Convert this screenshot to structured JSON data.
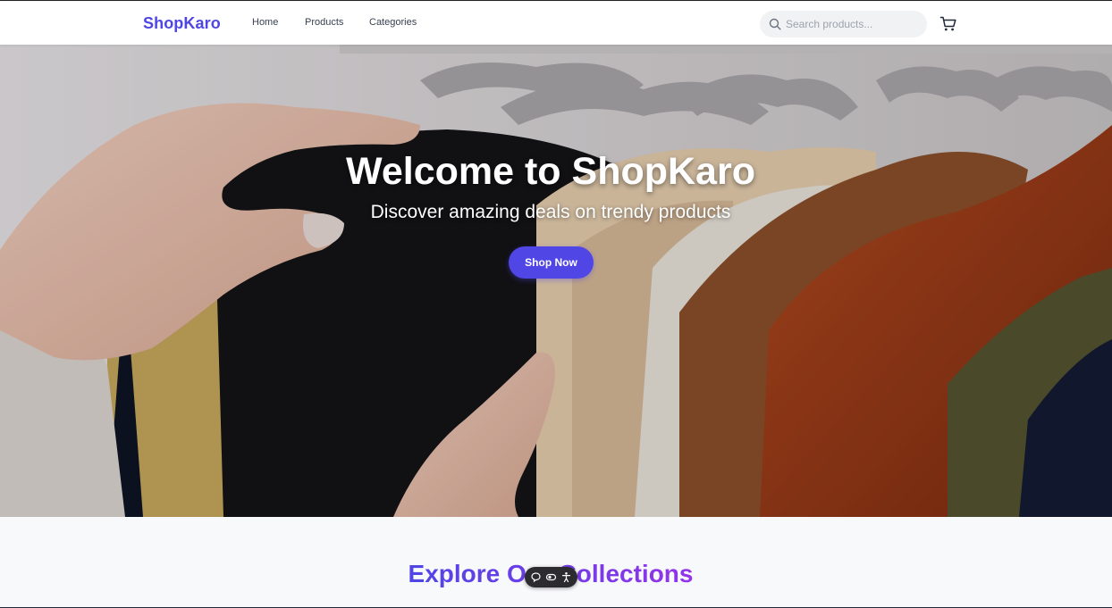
{
  "brand": {
    "name": "ShopKaro",
    "color": "#4f46e5"
  },
  "nav": {
    "links": [
      {
        "label": "Home"
      },
      {
        "label": "Products"
      },
      {
        "label": "Categories"
      }
    ]
  },
  "search": {
    "placeholder": "Search products...",
    "value": "",
    "icon": "search-icon"
  },
  "cart": {
    "icon": "shopping-cart-icon"
  },
  "hero": {
    "title": "Welcome to ShopKaro",
    "subtitle": "Discover amazing deals on trendy products",
    "cta_label": "Shop Now",
    "image": "hands browsing clothes on hangers",
    "cta_color": "#4f46e5"
  },
  "section": {
    "title": "Explore Our Collections"
  },
  "floating_toolbar": {
    "icons": [
      "chat-bubble-icon",
      "toggle-icon",
      "accessibility-icon"
    ]
  }
}
